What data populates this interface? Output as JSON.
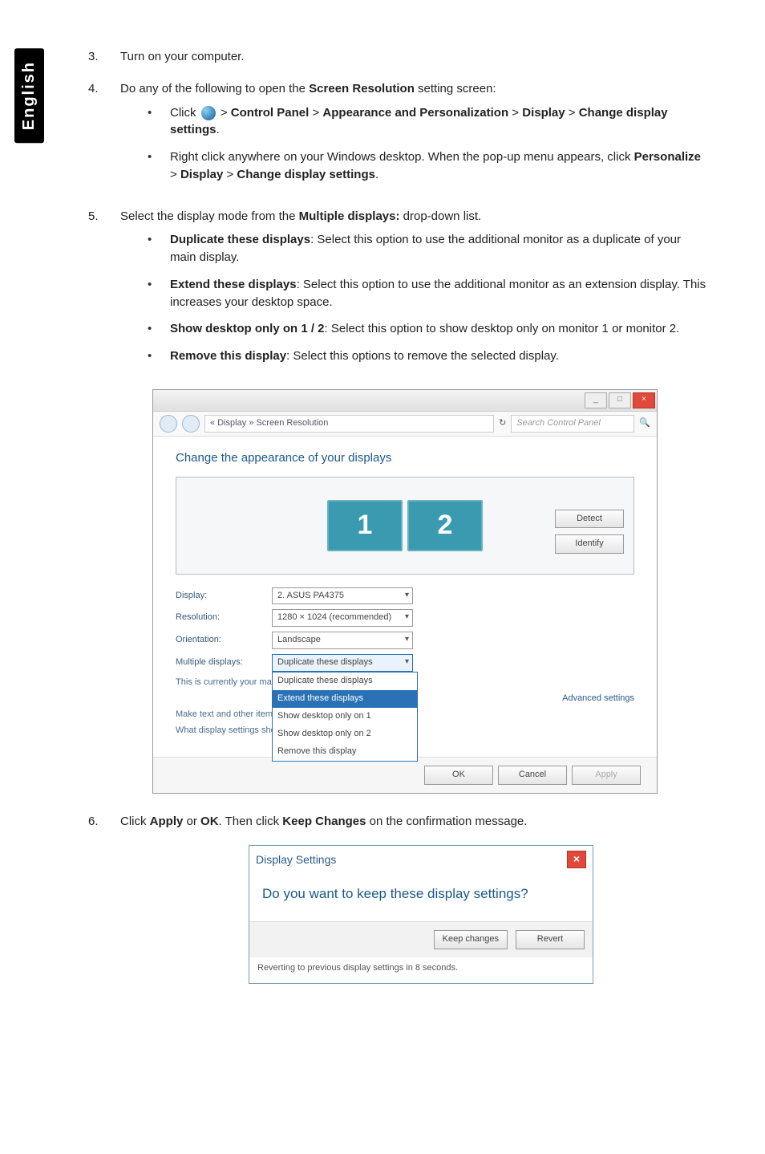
{
  "sidetab": "English",
  "steps": {
    "s3": {
      "num": "3.",
      "text": "Turn on your computer."
    },
    "s4": {
      "num": "4.",
      "intro_a": "Do any of the following to open the ",
      "intro_b": "Screen Resolution",
      "intro_c": " setting screen:",
      "bullets": {
        "b1": {
          "pre": "Click ",
          "p1": "Control Panel",
          "p2": "Appearance and Personalization",
          "p3": "Display",
          "p4": "Change display settings",
          "gt": " > "
        },
        "b2": {
          "line1": "Right click anywhere on your Windows desktop. When the pop-up menu appears, click ",
          "p1": "Personalize",
          "p2": "Display",
          "p3": "Change display settings"
        }
      }
    },
    "s5": {
      "num": "5.",
      "intro_a": "Select the display mode from the ",
      "intro_b": "Multiple displays:",
      "intro_c": " drop-down list.",
      "modes": {
        "m1": {
          "name": "Duplicate these displays",
          "desc": ": Select this option to use the additional monitor as a duplicate of your main display."
        },
        "m2": {
          "name": "Extend these displays",
          "desc": ": Select this option to use the additional monitor as an extension display. This increases your desktop space."
        },
        "m3": {
          "name": "Show desktop only on 1 / 2",
          "desc": ": Select this option to show desktop only on monitor 1 or monitor 2."
        },
        "m4": {
          "name": "Remove this display",
          "desc": ": Select this options to remove the selected display."
        }
      }
    },
    "s6": {
      "num": "6.",
      "a": "Click ",
      "b": "Apply",
      "c": " or ",
      "d": "OK",
      "e": ". Then click ",
      "f": "Keep Changes",
      "g": " on the confirmation message."
    }
  },
  "dlg1": {
    "crumbs": "« Display » Screen Resolution",
    "search": "Search Control Panel",
    "heading": "Change the appearance of your displays",
    "mon1": "1",
    "mon2": "2",
    "detect": "Detect",
    "identify": "Identify",
    "labels": {
      "display": "Display:",
      "resolution": "Resolution:",
      "orientation": "Orientation:",
      "multiple": "Multiple displays:"
    },
    "values": {
      "display": "2. ASUS PA4375",
      "resolution": "1280 × 1024 (recommended)",
      "orientation": "Landscape",
      "multiple": "Duplicate these displays"
    },
    "dd": {
      "o1": "Duplicate these displays",
      "o2": "Extend these displays",
      "o3": "Show desktop only on 1",
      "o4": "Show desktop only on 2",
      "o5": "Remove this display"
    },
    "hint1": "This is currently your main display.",
    "hint2": "Make text and other items larger or smaller",
    "hint3": "What display settings should I choose?",
    "adv": "Advanced settings",
    "ok": "OK",
    "cancel": "Cancel",
    "apply": "Apply"
  },
  "dlg2": {
    "title": "Display Settings",
    "question": "Do you want to keep these display settings?",
    "keep": "Keep changes",
    "revert": "Revert",
    "note": "Reverting to previous display settings in 8 seconds."
  }
}
